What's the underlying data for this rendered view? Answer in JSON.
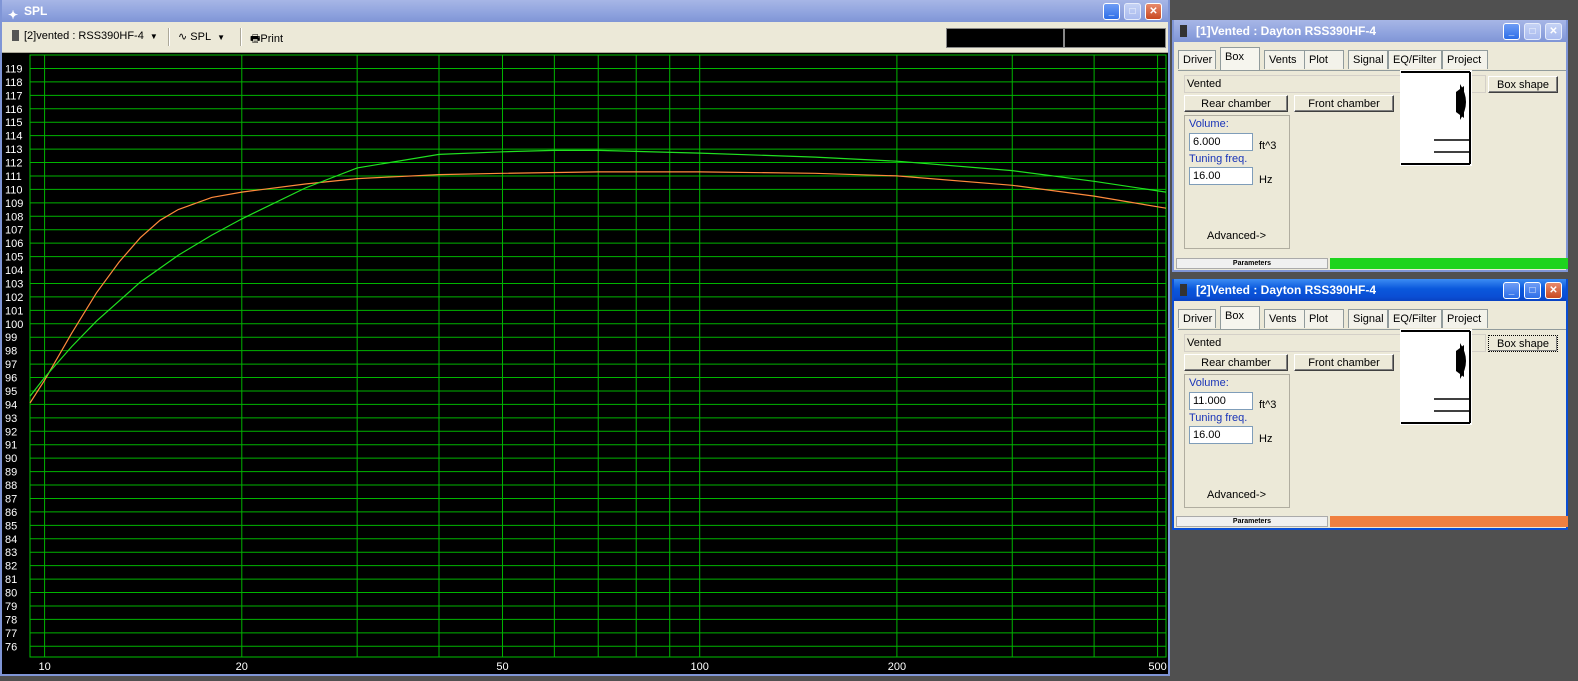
{
  "spl_window": {
    "title": "SPL",
    "toolbar": {
      "project_select": "[2]vented : RSS390HF-4",
      "view_select": "SPL",
      "print_label": "Print"
    }
  },
  "chart_data": {
    "type": "line",
    "x_scale": "log",
    "xlim": [
      9.5,
      515
    ],
    "ylim": [
      75.2,
      120
    ],
    "x_ticks": [
      10,
      20,
      50,
      100,
      200,
      500
    ],
    "y_ticks": [
      76,
      77,
      78,
      79,
      80,
      81,
      82,
      83,
      84,
      85,
      86,
      87,
      88,
      89,
      90,
      91,
      92,
      93,
      94,
      95,
      96,
      97,
      98,
      99,
      100,
      101,
      102,
      103,
      104,
      105,
      106,
      107,
      108,
      109,
      110,
      111,
      112,
      113,
      114,
      115,
      116,
      117,
      118,
      119
    ],
    "grid": true,
    "series": [
      {
        "color": "#ff8a3c",
        "x": [
          9.5,
          10,
          11,
          12,
          13,
          14,
          15,
          16,
          18,
          20,
          25,
          30,
          40,
          50,
          70,
          100,
          150,
          200,
          300,
          400,
          515
        ],
        "y": [
          94.1,
          95.8,
          99.3,
          102.3,
          104.6,
          106.4,
          107.7,
          108.5,
          109.4,
          109.8,
          110.4,
          110.8,
          111.1,
          111.2,
          111.3,
          111.3,
          111.2,
          111.0,
          110.3,
          109.5,
          108.6
        ]
      },
      {
        "color": "#20e020",
        "x": [
          9.5,
          10,
          11,
          12,
          14,
          16,
          18,
          20,
          25,
          30,
          40,
          50,
          60,
          70,
          100,
          150,
          200,
          300,
          400,
          515
        ],
        "y": [
          94.6,
          96.0,
          98.3,
          100.2,
          103.1,
          105.1,
          106.6,
          107.8,
          110.1,
          111.6,
          112.6,
          112.8,
          112.9,
          112.9,
          112.7,
          112.4,
          112.1,
          111.4,
          110.6,
          109.8
        ]
      }
    ]
  },
  "panels": [
    {
      "title": "[1]Vented : Dayton RSS390HF-4",
      "tabs": [
        "Driver",
        "Box",
        "Vents",
        "Plot",
        "Signal",
        "EQ/Filter",
        "Project"
      ],
      "selected_tab": "Box",
      "box_type": "Vented",
      "box_shape_label": "Box shape",
      "rear_label": "Rear chamber",
      "front_label": "Front chamber",
      "volume_label": "Volume:",
      "volume": "6.000",
      "volume_unit": "ft^3",
      "tuning_label": "Tuning freq.",
      "tuning": "16.00",
      "tuning_unit": "Hz",
      "advanced_label": "Advanced->",
      "status_label": "Parameters",
      "status_color": "#1ed41e"
    },
    {
      "title": "[2]Vented : Dayton RSS390HF-4",
      "tabs": [
        "Driver",
        "Box",
        "Vents",
        "Plot",
        "Signal",
        "EQ/Filter",
        "Project"
      ],
      "selected_tab": "Box",
      "box_type": "Vented",
      "box_shape_label": "Box shape",
      "rear_label": "Rear chamber",
      "front_label": "Front chamber",
      "volume_label": "Volume:",
      "volume": "11.000",
      "volume_unit": "ft^3",
      "tuning_label": "Tuning freq.",
      "tuning": "16.00",
      "tuning_unit": "Hz",
      "advanced_label": "Advanced->",
      "status_label": "Parameters",
      "status_color": "#f08040"
    }
  ]
}
